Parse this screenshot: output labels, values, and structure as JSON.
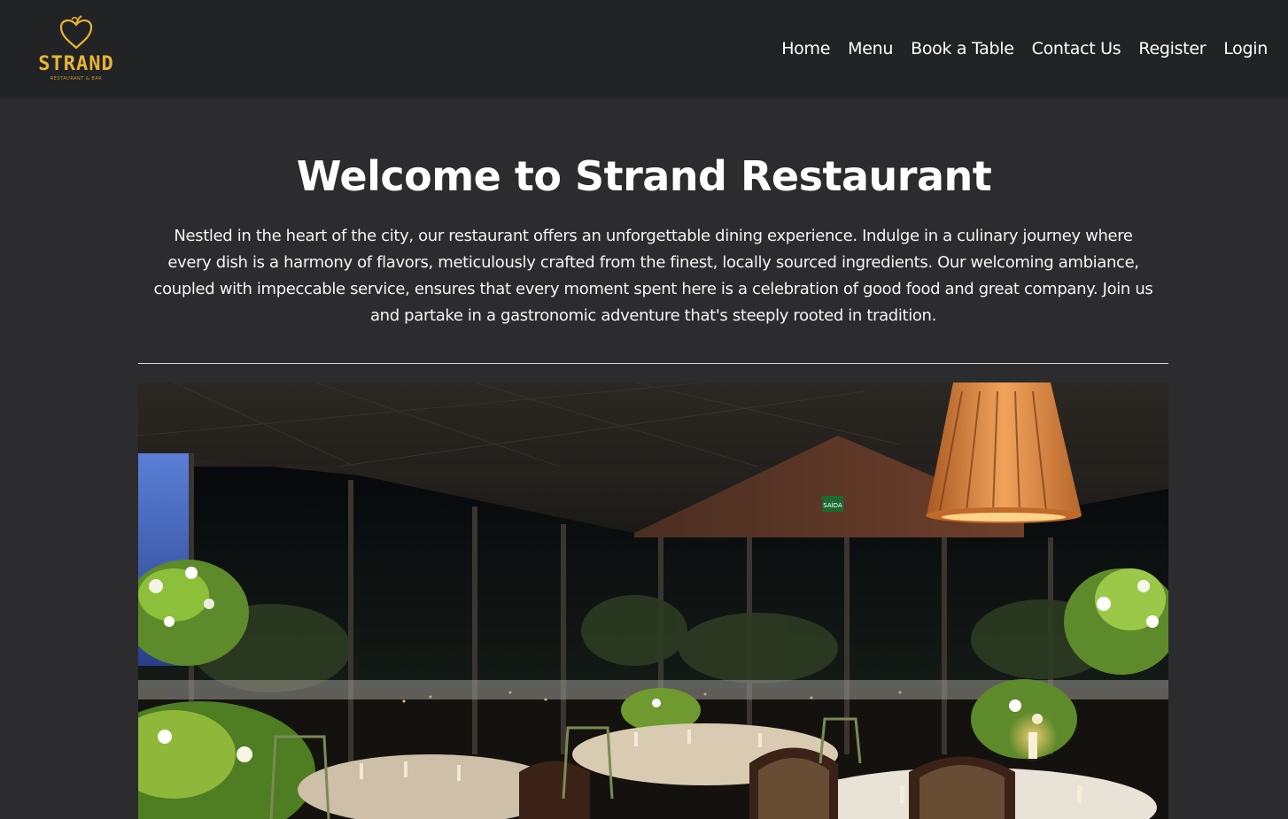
{
  "brand": {
    "name": "STRAND",
    "tagline": "RESTAURANT & BAR",
    "color": "#e8b436"
  },
  "nav": {
    "items": [
      "Home",
      "Menu",
      "Book a Table",
      "Contact Us",
      "Register",
      "Login"
    ]
  },
  "hero": {
    "title": "Welcome to Strand Restaurant",
    "description": "Nestled in the heart of the city, our restaurant offers an unforgettable dining experience. Indulge in a culinary journey where every dish is a harmony of flavors, meticulously crafted from the finest, locally sourced ingredients. Our welcoming ambiance, coupled with impeccable service, ensures that every moment spent here is a celebration of good food and great company. Join us and partake in a gastronomic adventure that's steeply rooted in tradition."
  },
  "photo": {
    "exit_sign": "SAÍDA"
  },
  "colors": {
    "page_bg": "#2c2c2e",
    "nav_bg": "#222325",
    "text": "#ffffff"
  }
}
